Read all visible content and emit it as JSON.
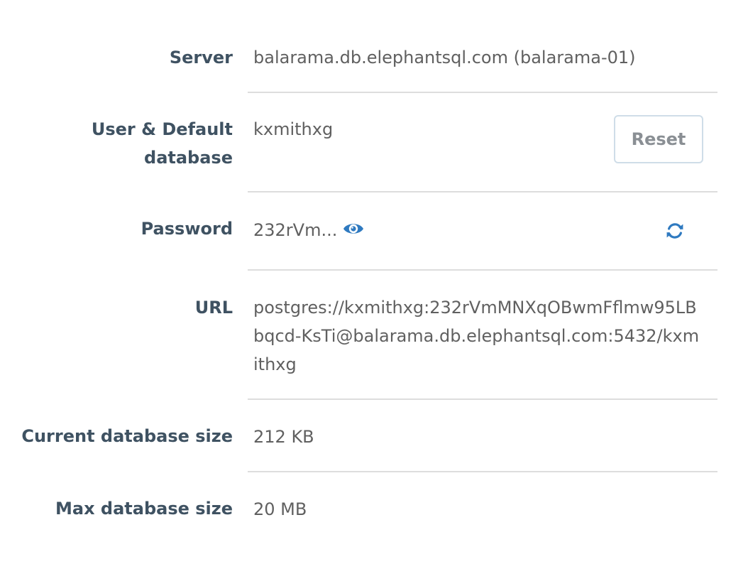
{
  "rows": [
    {
      "label": "Server",
      "value": "balarama.db.elephantsql.com (balarama-01)"
    },
    {
      "label": "User & Default database",
      "value": "kxmithxg",
      "action": "Reset"
    },
    {
      "label": "Password",
      "value": "232rVm...",
      "icons": [
        "eye-icon",
        "refresh-icon"
      ]
    },
    {
      "label": "URL",
      "value": "postgres://kxmithxg:232rVmMNXqOBwmFflmw95LBbqcd-KsTi@balarama.db.elephantsql.com:5432/kxmithxg"
    },
    {
      "label": "Current database size",
      "value": "212 KB"
    },
    {
      "label": "Max database size",
      "value": "20 MB"
    }
  ],
  "colors": {
    "label": "#3f5262",
    "value": "#606060",
    "divider": "#dddddd",
    "icon_accent": "#2f7ac0",
    "button_border": "#cfdde8",
    "button_text": "#8a8f94"
  }
}
